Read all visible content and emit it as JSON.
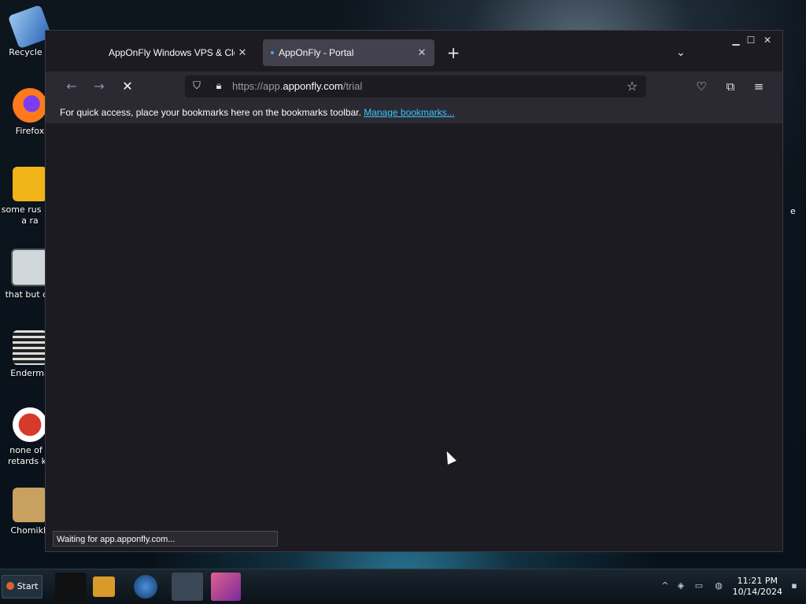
{
  "desktop": {
    "icons": [
      {
        "label": "Recycle B",
        "icon": "recycle-bin-icon"
      },
      {
        "label": "Firefox",
        "icon": "firefox-icon"
      },
      {
        "label": "some rus ran a ra",
        "icon": "app-icon"
      },
      {
        "label": "that but c#",
        "icon": "stack-icon"
      },
      {
        "label": "Enderma",
        "icon": "list-icon"
      },
      {
        "label": "none of y retards kn",
        "icon": "dino-icon"
      },
      {
        "label": "ChomikB",
        "icon": "hamster-icon"
      }
    ],
    "right_fragment": "e"
  },
  "browser": {
    "tabs": [
      {
        "title": "AppOnFly Windows VPS & Clou",
        "active": false
      },
      {
        "title": "AppOnFly - Portal",
        "active": true
      }
    ],
    "url": {
      "scheme": "https://",
      "sub": "app.",
      "host": "apponfly.com",
      "path": "/trial"
    },
    "bookmarks_bar": {
      "text": "For quick access, place your bookmarks here on the bookmarks toolbar.",
      "link": "Manage bookmarks..."
    },
    "status": "Waiting for app.apponfly.com..."
  },
  "taskbar": {
    "start_label": "Start",
    "time": "11:21 PM",
    "date": "10/14/2024"
  },
  "colors": {
    "accent": "#3dc3ff",
    "tab_active": "#42414d",
    "chrome": "#2b2a33",
    "content": "#1c1b22"
  }
}
